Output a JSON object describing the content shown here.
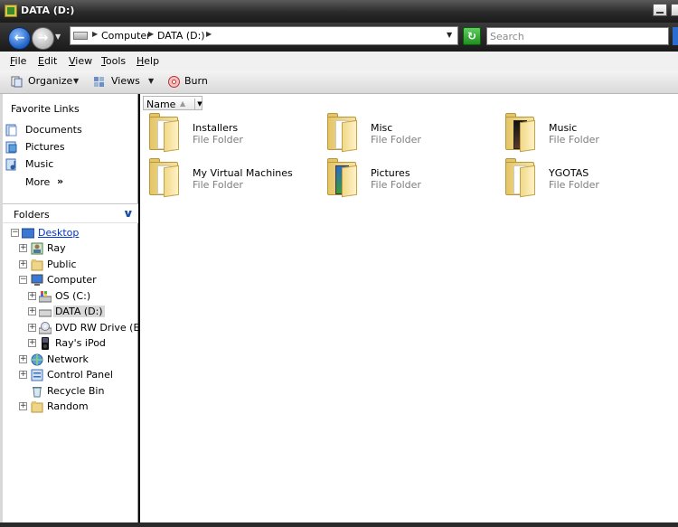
{
  "window": {
    "title": "DATA (D:)"
  },
  "address": {
    "crumbs": [
      "Computer",
      "DATA (D:)"
    ],
    "search_placeholder": "Search"
  },
  "menu": [
    "File",
    "Edit",
    "View",
    "Tools",
    "Help"
  ],
  "commands": {
    "organize": "Organize",
    "views": "Views",
    "burn": "Burn"
  },
  "favorites": {
    "header": "Favorite Links",
    "items": [
      {
        "label": "Documents",
        "icon": "documents-icon"
      },
      {
        "label": "Pictures",
        "icon": "pictures-icon"
      },
      {
        "label": "Music",
        "icon": "music-icon"
      }
    ],
    "more": "More",
    "more_glyph": "»"
  },
  "folders_pane": {
    "title": "Folders",
    "tree": [
      {
        "label": "Desktop",
        "icon": "desktop-icon",
        "expander": "−"
      },
      {
        "label": "Ray",
        "icon": "user-icon",
        "expander": "+"
      },
      {
        "label": "Public",
        "icon": "folder-icon",
        "expander": "+"
      },
      {
        "label": "Computer",
        "icon": "computer-icon",
        "expander": "−"
      },
      {
        "label": "OS (C:)",
        "icon": "drive-icon",
        "expander": "+"
      },
      {
        "label": "DATA (D:)",
        "icon": "drive-icon",
        "expander": "+"
      },
      {
        "label": "DVD RW Drive (E:)",
        "icon": "dvd-drive-icon",
        "expander": "+"
      },
      {
        "label": "Ray's iPod",
        "icon": "ipod-icon",
        "expander": "+"
      },
      {
        "label": "Network",
        "icon": "network-icon",
        "expander": "+"
      },
      {
        "label": "Control Panel",
        "icon": "control-panel-icon",
        "expander": "+"
      },
      {
        "label": "Recycle Bin",
        "icon": "recycle-bin-icon",
        "expander": ""
      },
      {
        "label": "Random",
        "icon": "folder-icon",
        "expander": "+"
      }
    ]
  },
  "content": {
    "column_header": "Name",
    "items": [
      {
        "name": "Installers",
        "type": "File Folder"
      },
      {
        "name": "Misc",
        "type": "File Folder"
      },
      {
        "name": "Music",
        "type": "File Folder"
      },
      {
        "name": "My Virtual Machines",
        "type": "File Folder"
      },
      {
        "name": "Pictures",
        "type": "File Folder"
      },
      {
        "name": "YGOTAS",
        "type": "File Folder"
      }
    ]
  },
  "colors": {
    "accent": "#1d5fc2",
    "link": "#0033cc",
    "folder": "#e4c568"
  }
}
